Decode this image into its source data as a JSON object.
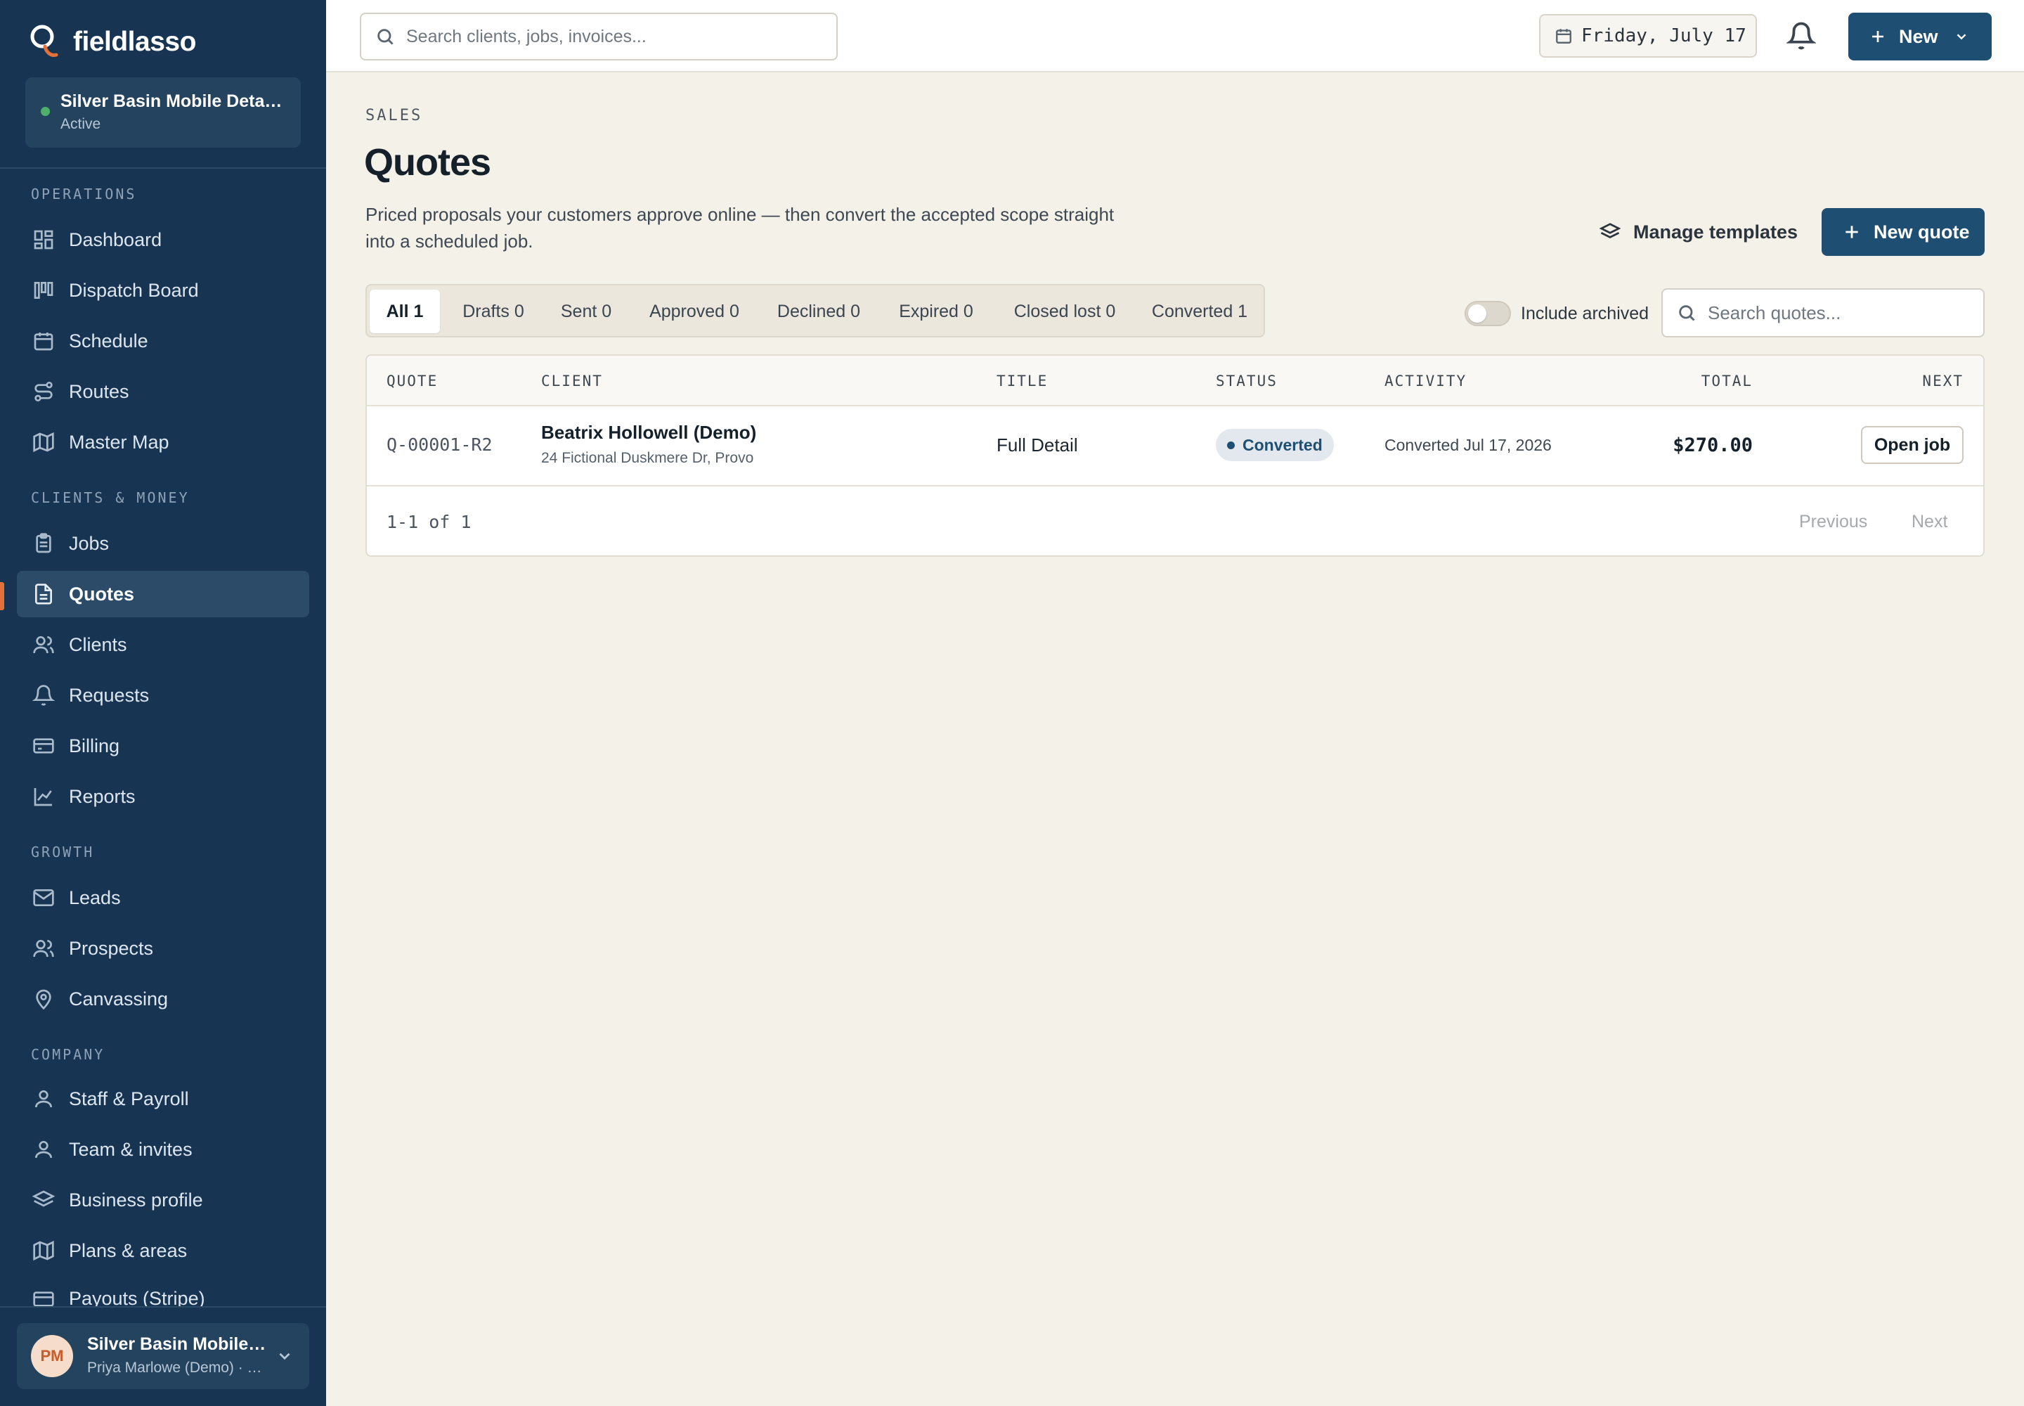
{
  "app": {
    "brand": "fieldlasso"
  },
  "workspace": {
    "name": "Silver Basin Mobile Detailing",
    "status": "Active",
    "status_color": "#4fb06a"
  },
  "sidebar": {
    "sections": [
      {
        "label": "OPERATIONS",
        "items": [
          {
            "label": "Dashboard",
            "icon": "dashboard-icon"
          },
          {
            "label": "Dispatch Board",
            "icon": "board-icon"
          },
          {
            "label": "Schedule",
            "icon": "calendar-icon"
          },
          {
            "label": "Routes",
            "icon": "route-icon"
          },
          {
            "label": "Master Map",
            "icon": "map-icon"
          }
        ]
      },
      {
        "label": "CLIENTS & MONEY",
        "items": [
          {
            "label": "Jobs",
            "icon": "clipboard-icon"
          },
          {
            "label": "Quotes",
            "icon": "document-icon",
            "active": true
          },
          {
            "label": "Clients",
            "icon": "users-icon"
          },
          {
            "label": "Requests",
            "icon": "bell-icon"
          },
          {
            "label": "Billing",
            "icon": "credit-card-icon"
          },
          {
            "label": "Reports",
            "icon": "chart-icon"
          }
        ]
      },
      {
        "label": "GROWTH",
        "items": [
          {
            "label": "Leads",
            "icon": "mail-icon"
          },
          {
            "label": "Prospects",
            "icon": "users-icon"
          },
          {
            "label": "Canvassing",
            "icon": "map-pin-icon"
          }
        ]
      },
      {
        "label": "COMPANY",
        "items": [
          {
            "label": "Staff & Payroll",
            "icon": "user-icon"
          },
          {
            "label": "Team & invites",
            "icon": "user-icon"
          },
          {
            "label": "Business profile",
            "icon": "layers-icon"
          },
          {
            "label": "Plans & areas",
            "icon": "map-icon"
          },
          {
            "label": "Payouts (Stripe)",
            "icon": "credit-card-icon"
          }
        ]
      }
    ],
    "accent_color": "#e0713a"
  },
  "user": {
    "initials": "PM",
    "name": "Silver Basin Mobile Detailing",
    "sub": "Priya Marlowe (Demo) · Owner"
  },
  "topbar": {
    "search_placeholder": "Search clients, jobs, invoices...",
    "date": "Friday, July 17",
    "new_label": "New"
  },
  "page": {
    "eyebrow": "SALES",
    "title": "Quotes",
    "description": "Priced proposals your customers approve online — then convert the accepted scope straight into a scheduled job.",
    "manage_templates_label": "Manage templates",
    "new_quote_label": "New quote",
    "include_archived_label": "Include archived",
    "include_archived": false,
    "search_placeholder": "Search quotes..."
  },
  "filters": [
    {
      "label": "All 1",
      "active": true
    },
    {
      "label": "Drafts 0"
    },
    {
      "label": "Sent 0"
    },
    {
      "label": "Approved 0"
    },
    {
      "label": "Declined 0"
    },
    {
      "label": "Expired 0"
    },
    {
      "label": "Closed lost 0"
    },
    {
      "label": "Converted 1"
    }
  ],
  "table": {
    "columns": [
      "QUOTE",
      "CLIENT",
      "TITLE",
      "STATUS",
      "ACTIVITY",
      "TOTAL",
      "NEXT"
    ],
    "rows": [
      {
        "quote": "Q-00001-R2",
        "client": "Beatrix Hollowell (Demo)",
        "address": "24 Fictional Duskmere Dr, Provo",
        "title": "Full Detail",
        "status": "Converted",
        "activity": "Converted Jul 17, 2026",
        "total": "$270.00",
        "next_action": "Open job"
      }
    ],
    "pagination": {
      "summary": "1-1 of 1",
      "previous": "Previous",
      "next": "Next"
    }
  },
  "colors": {
    "primary": "#1f4e73",
    "sidebar": "#173553",
    "background": "#f4f1e9"
  }
}
